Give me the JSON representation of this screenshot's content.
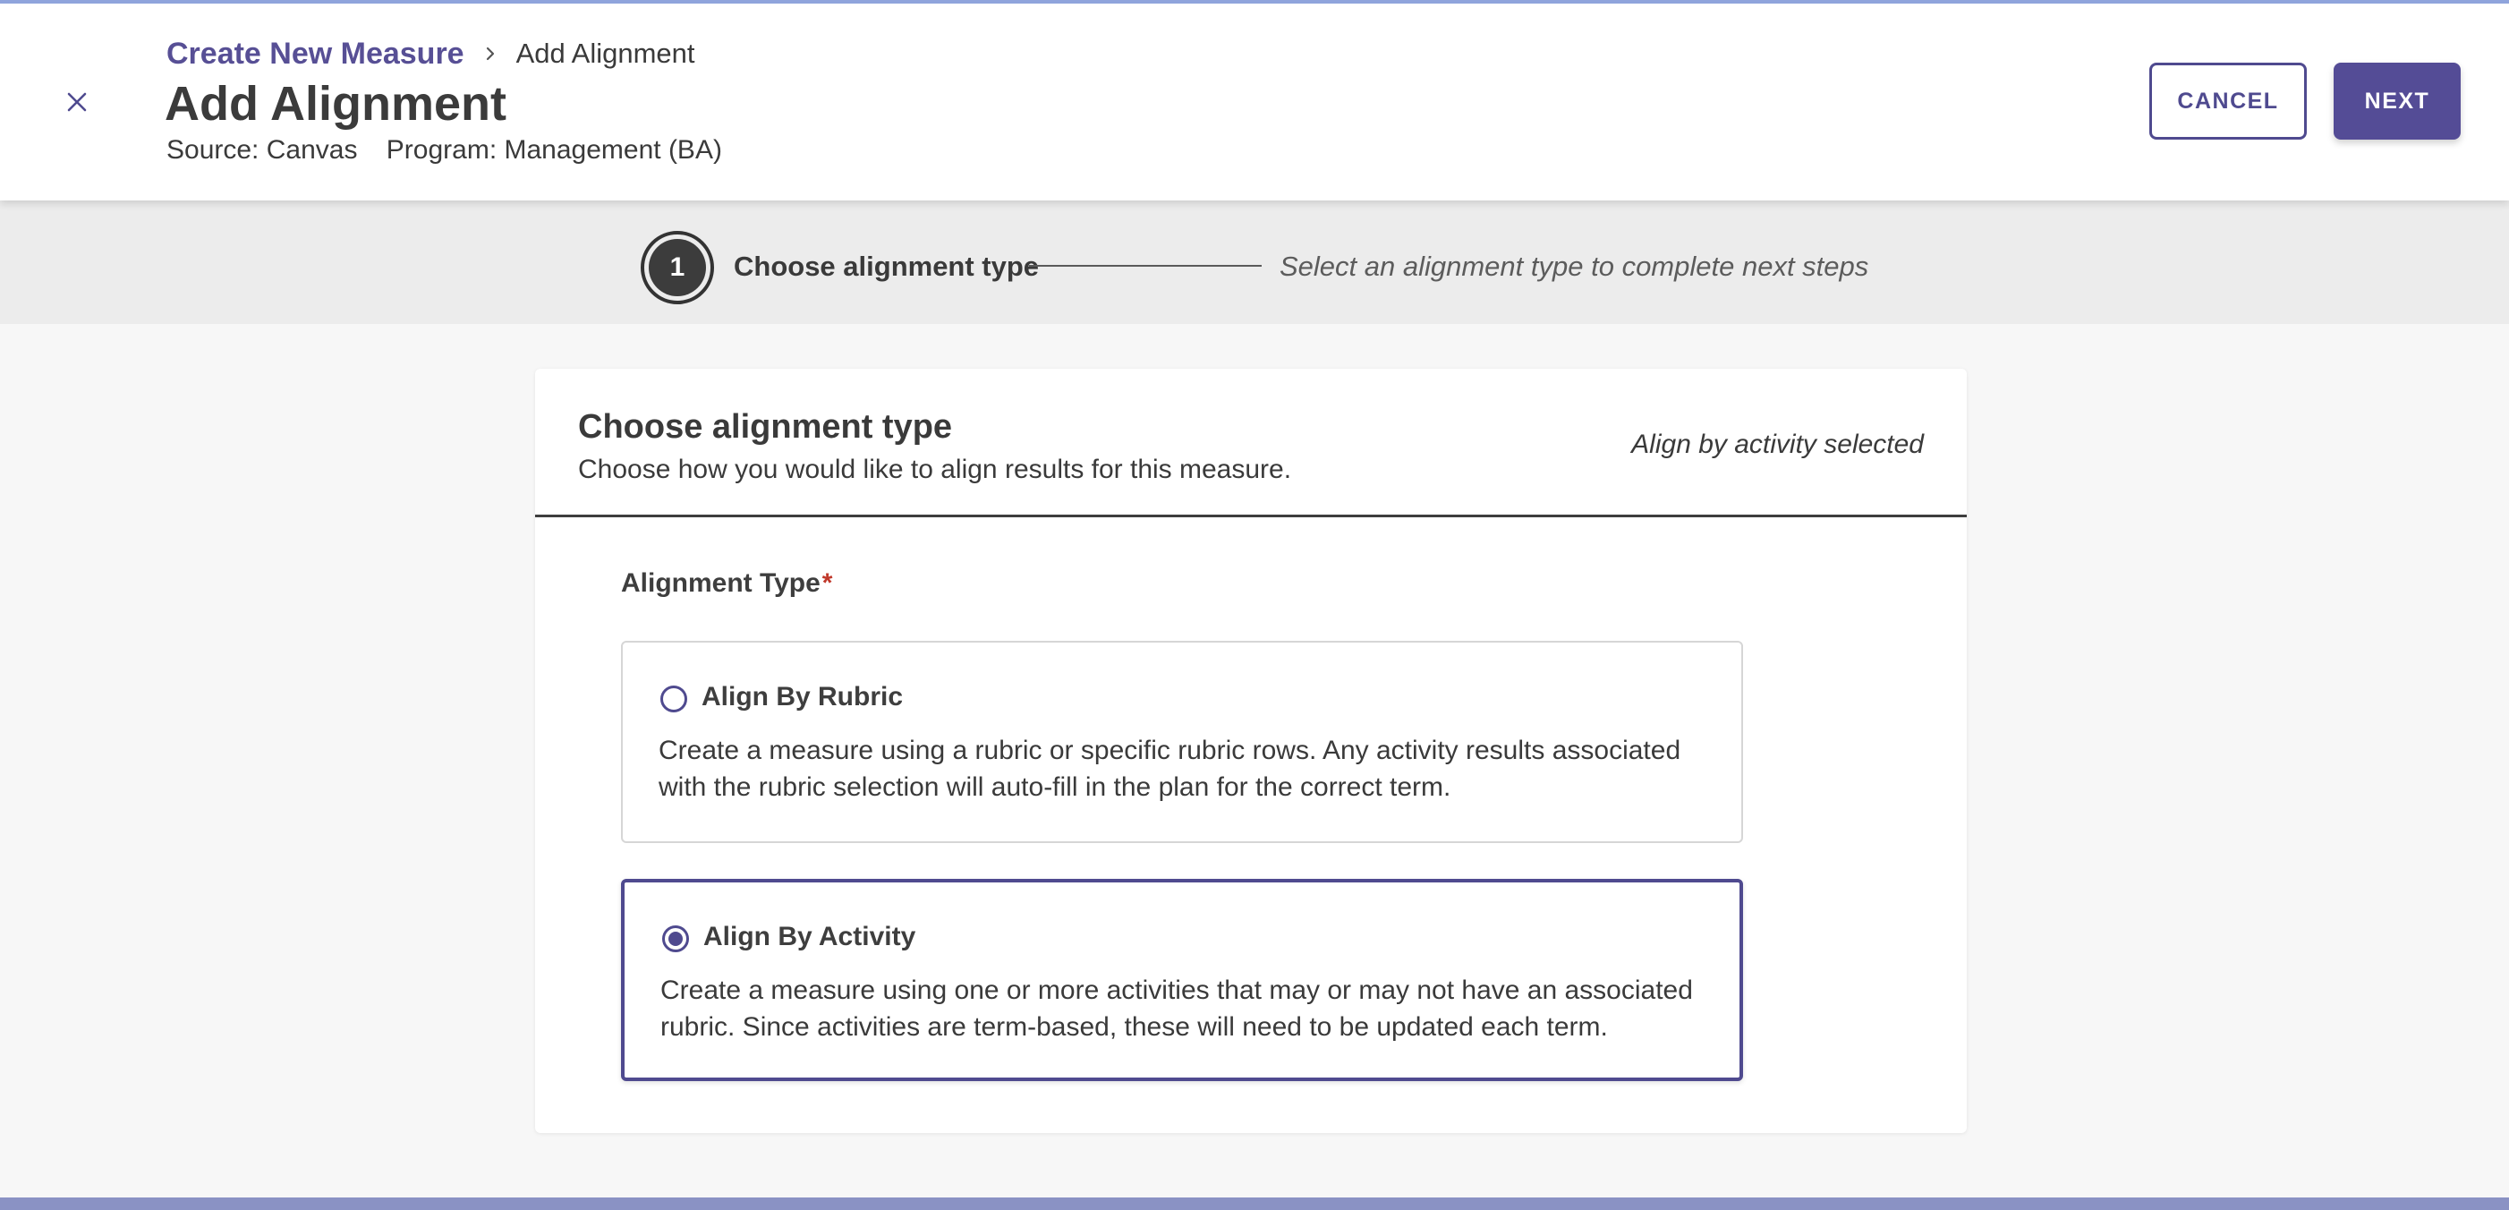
{
  "header": {
    "breadcrumb": {
      "parent": "Create New Measure",
      "current": "Add Alignment"
    },
    "title": "Add Alignment",
    "source": "Source: Canvas",
    "program": "Program: Management (BA)",
    "cancel_label": "CANCEL",
    "next_label": "NEXT",
    "icons": {
      "close": "close-icon",
      "separator": "chevron-right-icon"
    }
  },
  "stepper": {
    "step_number": "1",
    "step_label": "Choose alignment type",
    "hint": "Select an alignment type to complete next steps"
  },
  "card": {
    "title": "Choose alignment type",
    "subtitle": "Choose how you would like to align results for this measure.",
    "status": "Align by activity selected",
    "field_label": "Alignment Type",
    "required_marker": "*",
    "options": [
      {
        "title": "Align By Rubric",
        "description": "Create a measure using a rubric or specific rubric rows. Any activity results associated with the rubric selection will auto-fill in the plan for the correct term.",
        "selected": false
      },
      {
        "title": "Align By Activity",
        "description": "Create a measure using one or more activities that may or may not have an associated rubric. Since activities are term-based, these will need to be updated each term.",
        "selected": true
      }
    ]
  },
  "colors": {
    "accent": "#544c96",
    "required": "#c0392b",
    "top_border": "#8fa4dc"
  }
}
